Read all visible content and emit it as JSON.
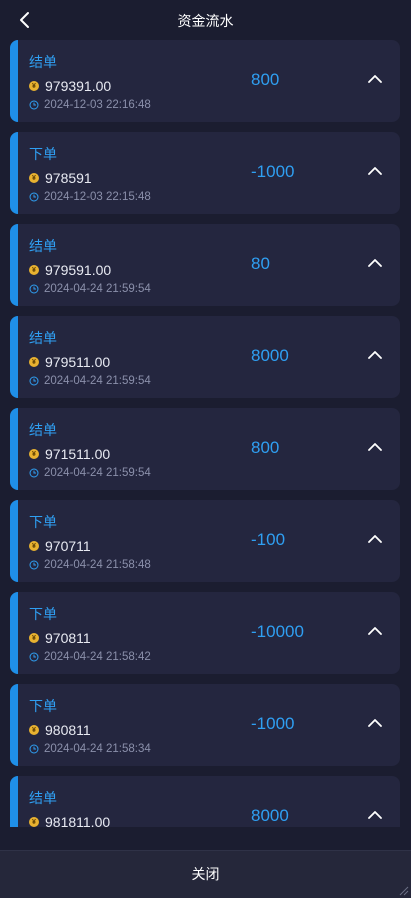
{
  "header": {
    "title": "资金流水"
  },
  "records": [
    {
      "type": "结单",
      "balance": "979391.00",
      "time": "2024-12-03 22:16:48",
      "change": "800"
    },
    {
      "type": "下单",
      "balance": "978591",
      "time": "2024-12-03 22:15:48",
      "change": "-1000"
    },
    {
      "type": "结单",
      "balance": "979591.00",
      "time": "2024-04-24 21:59:54",
      "change": "80"
    },
    {
      "type": "结单",
      "balance": "979511.00",
      "time": "2024-04-24 21:59:54",
      "change": "8000"
    },
    {
      "type": "结单",
      "balance": "971511.00",
      "time": "2024-04-24 21:59:54",
      "change": "800"
    },
    {
      "type": "下单",
      "balance": "970711",
      "time": "2024-04-24 21:58:48",
      "change": "-100"
    },
    {
      "type": "下单",
      "balance": "970811",
      "time": "2024-04-24 21:58:42",
      "change": "-10000"
    },
    {
      "type": "下单",
      "balance": "980811",
      "time": "2024-04-24 21:58:34",
      "change": "-1000"
    },
    {
      "type": "结单",
      "balance": "981811.00",
      "time": "",
      "change": "8000"
    }
  ],
  "footer": {
    "close_label": "关闭"
  },
  "colors": {
    "accent": "#1f8fe8",
    "value": "#2f9ff2",
    "coin": "#e8b230",
    "background": "#1b1d30",
    "card": "#24263f"
  },
  "icons": {
    "back": "chevron-left-icon",
    "coin": "coin-icon",
    "clock": "clock-icon",
    "expand": "chevron-up-icon"
  }
}
